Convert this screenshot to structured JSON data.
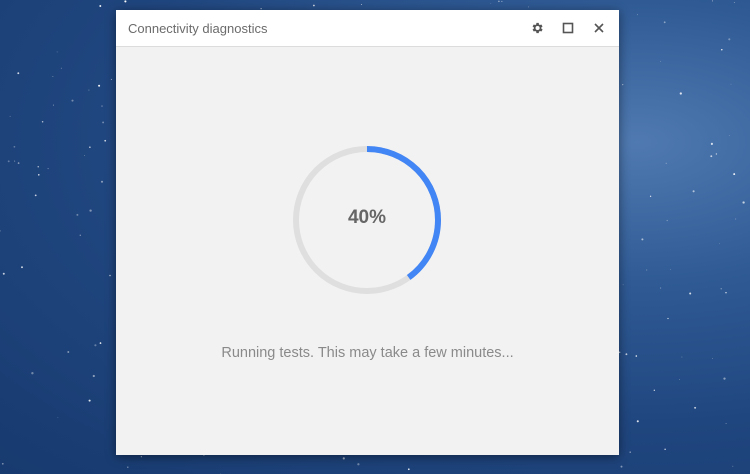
{
  "window": {
    "title": "Connectivity diagnostics"
  },
  "titlebar_icons": [
    "gear-icon",
    "maximize-icon",
    "close-icon"
  ],
  "progress": {
    "value": 0.4,
    "label": "40%",
    "track_color": "#dfdfdf",
    "fill_color": "#4285f4"
  },
  "status": {
    "message": "Running tests. This may take a few minutes..."
  }
}
